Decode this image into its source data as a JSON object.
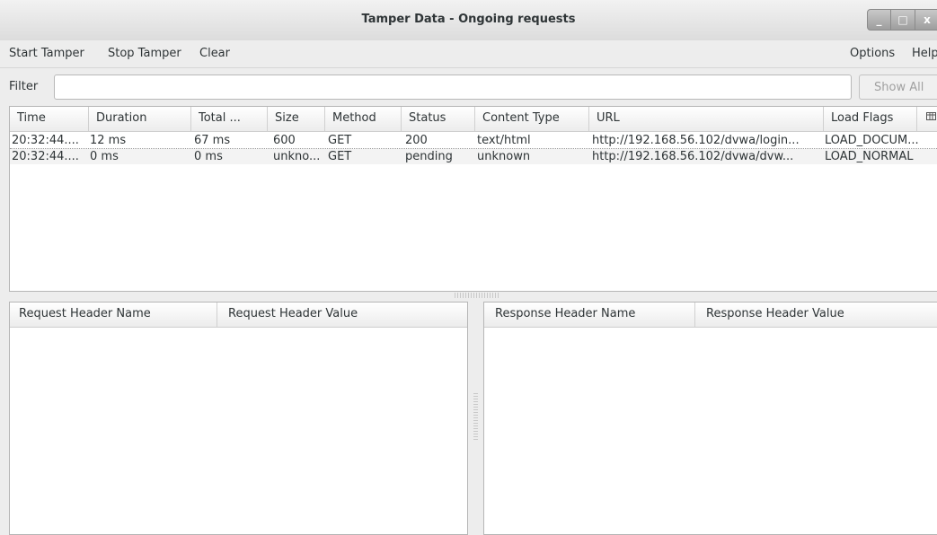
{
  "window": {
    "title": "Tamper Data - Ongoing requests",
    "controls": {
      "minimize": "_",
      "maximize": "□",
      "close": "x"
    }
  },
  "menubar": {
    "start_tamper": "Start Tamper",
    "stop_tamper": "Stop Tamper",
    "clear": "Clear",
    "options": "Options",
    "help": "Help"
  },
  "filter": {
    "label": "Filter",
    "value": "",
    "show_all": "Show All"
  },
  "requests": {
    "columns": [
      "Time",
      "Duration",
      "Total ...",
      "Size",
      "Method",
      "Status",
      "Content Type",
      "URL",
      "Load Flags"
    ],
    "column_picker_icon": "column-picker-icon",
    "rows": [
      [
        "20:32:44....",
        "12 ms",
        "67 ms",
        "600",
        "GET",
        "200",
        "text/html",
        "http://192.168.56.102/dvwa/login...",
        "LOAD_DOCUM..."
      ],
      [
        "20:32:44....",
        "0 ms",
        "0 ms",
        "unkno...",
        "GET",
        "pending",
        "unknown",
        "http://192.168.56.102/dvwa/dvw...",
        "LOAD_NORMAL"
      ]
    ]
  },
  "request_headers": {
    "columns": [
      "Request Header Name",
      "Request Header Value"
    ]
  },
  "response_headers": {
    "columns": [
      "Response Header Name",
      "Response Header Value"
    ]
  }
}
